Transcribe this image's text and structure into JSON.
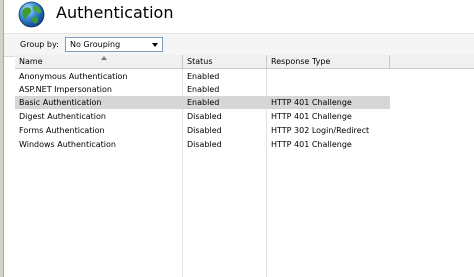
{
  "header": {
    "title": "Authentication",
    "icon": "globe-icon"
  },
  "toolbar": {
    "group_by_label": "Group by:",
    "group_by_value": "No Grouping"
  },
  "grid": {
    "columns": [
      "Name",
      "Status",
      "Response Type"
    ],
    "sorted_column": "Name",
    "rows": [
      {
        "name": "Anonymous Authentication",
        "status": "Enabled",
        "response_type": "",
        "selected": false
      },
      {
        "name": "ASP.NET Impersonation",
        "status": "Enabled",
        "response_type": "",
        "selected": false
      },
      {
        "name": "Basic Authentication",
        "status": "Enabled",
        "response_type": "HTTP 401 Challenge",
        "selected": true
      },
      {
        "name": "Digest Authentication",
        "status": "Disabled",
        "response_type": "HTTP 401 Challenge",
        "selected": false
      },
      {
        "name": "Forms Authentication",
        "status": "Disabled",
        "response_type": "HTTP 302 Login/Redirect",
        "selected": false
      },
      {
        "name": "Windows Authentication",
        "status": "Disabled",
        "response_type": "HTTP 401 Challenge",
        "selected": false
      }
    ]
  },
  "colors": {
    "selected_row": "#d6d6d6",
    "header_background": "#f0f0f0",
    "select_border": "#7f9db9"
  }
}
